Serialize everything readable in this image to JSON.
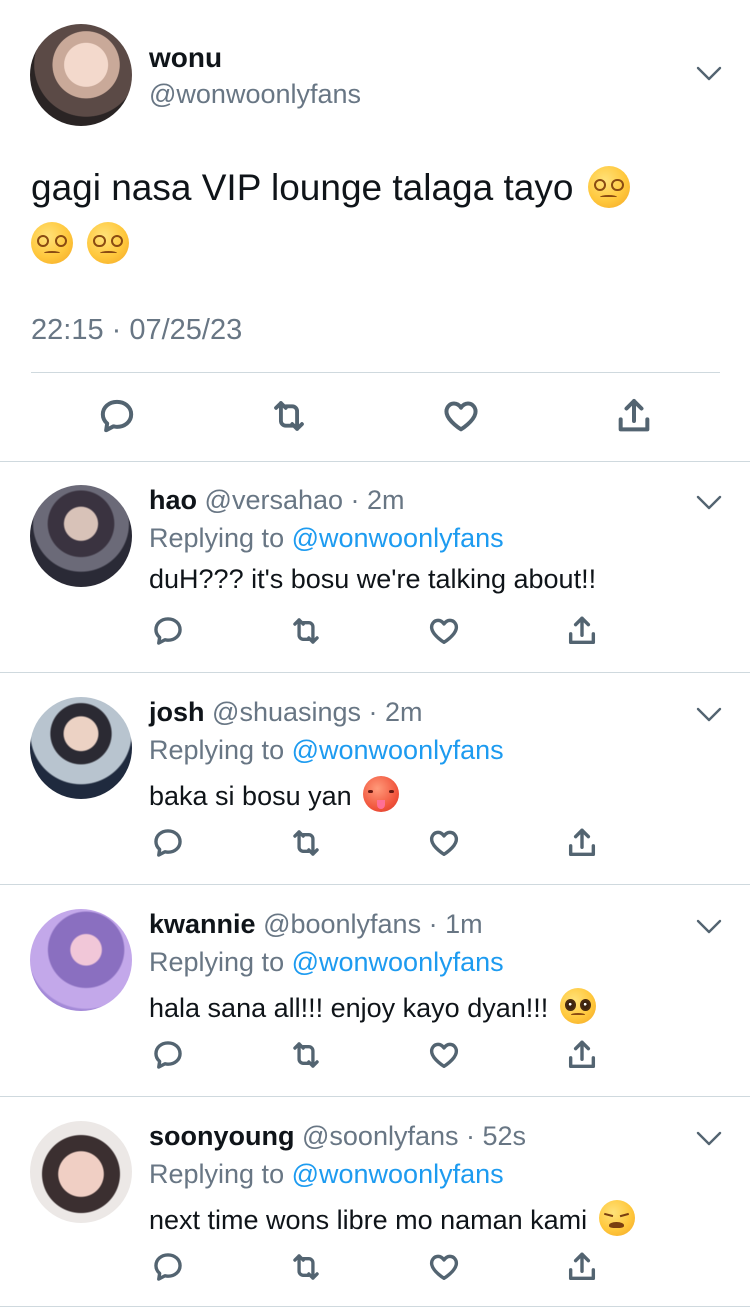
{
  "main_tweet": {
    "name": "wonu",
    "handle": "@wonwoonlyfans",
    "text": "gagi nasa VIP lounge talaga tayo",
    "emojis": [
      "dizzy-face-emoji",
      "dizzy-face-emoji",
      "dizzy-face-emoji"
    ],
    "timestamp": "22:15 · 07/25/23",
    "actions": [
      "reply-icon",
      "retweet-icon",
      "like-icon",
      "share-icon"
    ]
  },
  "replies": [
    {
      "name": "hao",
      "handle": "@versahao",
      "dot": "·",
      "time": "2m",
      "replying_prefix": "Replying to ",
      "replying_to": "@wonwoonlyfans",
      "text": "duH??? it's bosu we're talking about!!",
      "emoji": ""
    },
    {
      "name": "josh",
      "handle": "@shuasings",
      "dot": "·",
      "time": "2m",
      "replying_prefix": "Replying to ",
      "replying_to": "@wonwoonlyfans",
      "text": "baka si bosu yan",
      "emoji": "hot-face-emoji"
    },
    {
      "name": "kwannie",
      "handle": "@boonlyfans",
      "dot": "·",
      "time": "1m",
      "replying_prefix": "Replying to ",
      "replying_to": "@wonwoonlyfans",
      "text": "hala sana all!!! enjoy kayo dyan!!!",
      "emoji": "pleading-face-emoji"
    },
    {
      "name": "soonyoung",
      "handle": "@soonlyfans",
      "dot": "·",
      "time": "52s",
      "replying_prefix": "Replying to ",
      "replying_to": "@wonwoonlyfans",
      "text": "next time wons libre mo naman kami",
      "emoji": "weary-face-emoji"
    }
  ],
  "colors": {
    "text": "#0f1419",
    "secondary": "#687684",
    "link": "#1d9bf0",
    "divider": "#cfd9de",
    "icon": "#536471"
  }
}
